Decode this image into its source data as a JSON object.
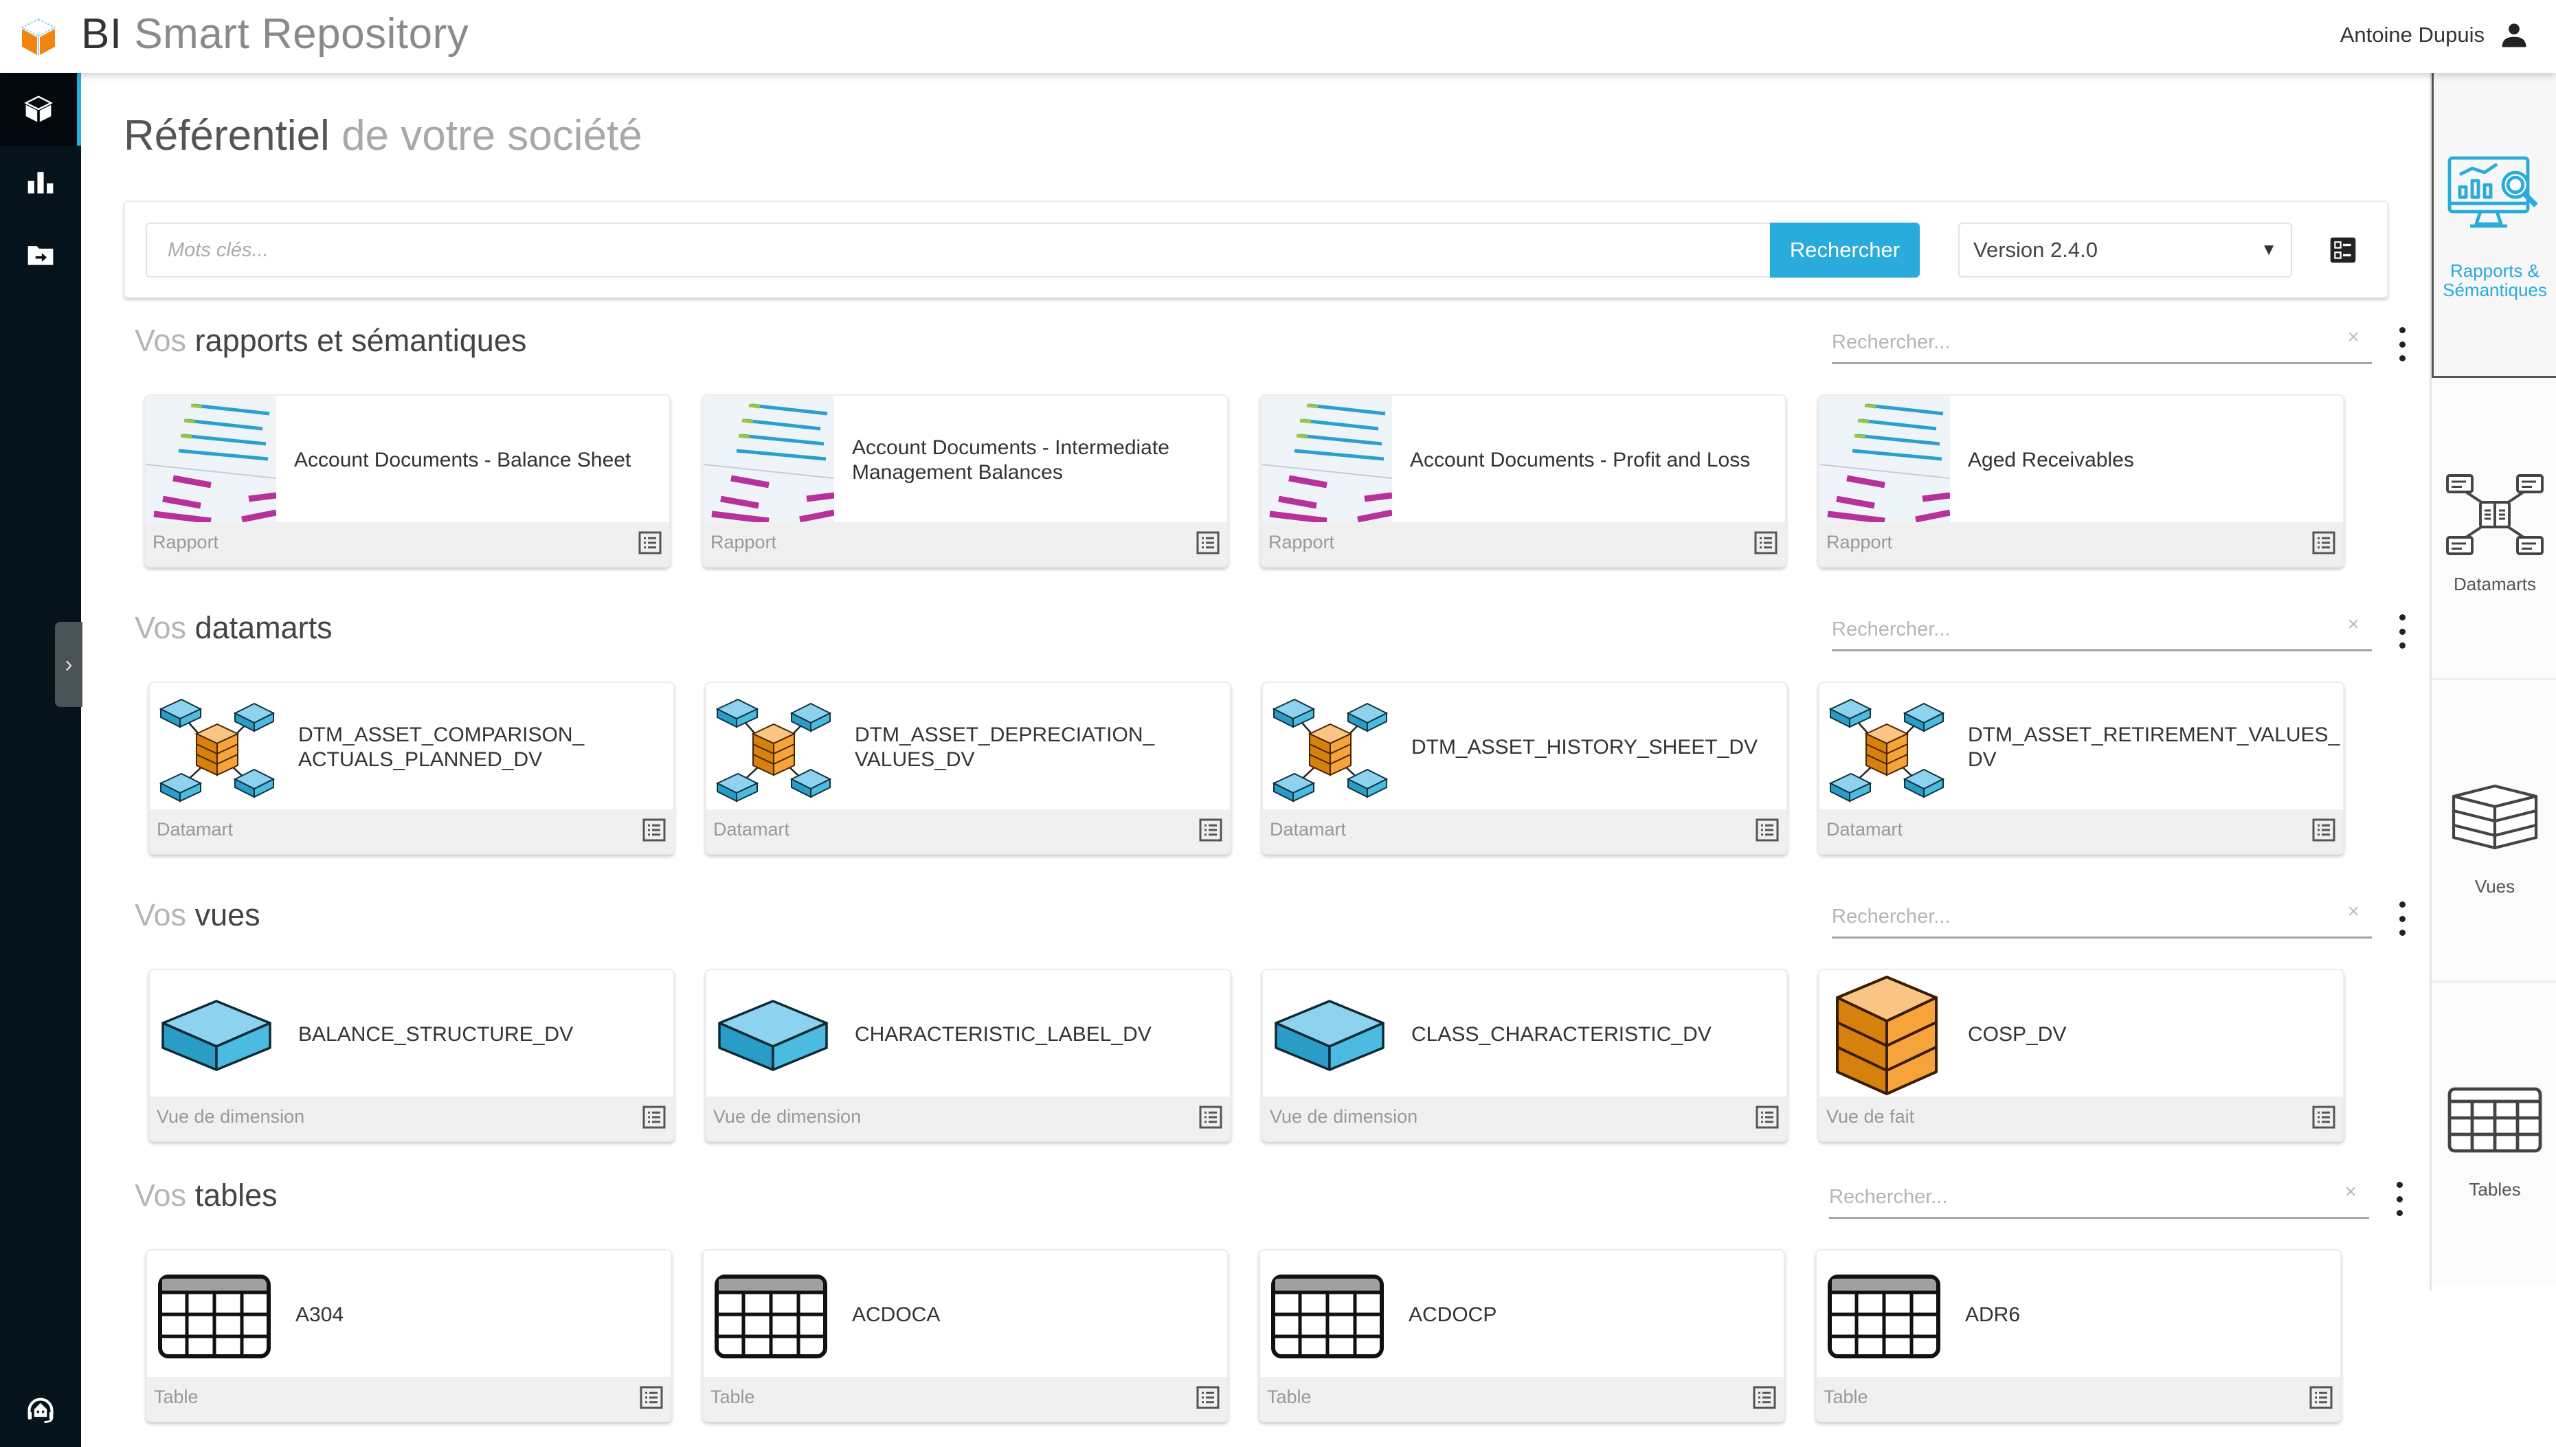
{
  "app": {
    "title_strong": "BI",
    "title_rest": "Smart Repository",
    "user_name": "Antoine Dupuis",
    "accent": "#29abdb"
  },
  "left_sidebar": {
    "items": [
      {
        "name": "repository",
        "icon": "cube-icon",
        "active": true
      },
      {
        "name": "statistics",
        "icon": "bar-chart-icon",
        "active": false
      },
      {
        "name": "import",
        "icon": "folder-arrow-icon",
        "active": false
      }
    ],
    "bottom_icon": "support-headset-icon",
    "collapse_label": "›"
  },
  "page": {
    "title_strong": "Référentiel",
    "title_light": "de votre société"
  },
  "search": {
    "placeholder": "Mots clés...",
    "value": "",
    "button_label": "Rechercher",
    "version": "Version 2.4.0"
  },
  "sections": [
    {
      "prefix": "Vos",
      "title": "rapports et sémantiques",
      "filter_placeholder": "Rechercher...",
      "clear_label": "×",
      "cards": [
        {
          "name": "Account Documents - Balance Sheet",
          "type": "Rapport"
        },
        {
          "name": "Account Documents - Intermediate Management Balances",
          "type": "Rapport"
        },
        {
          "name": "Account Documents - Profit and Loss",
          "type": "Rapport"
        },
        {
          "name": "Aged Receivables",
          "type": "Rapport"
        }
      ]
    },
    {
      "prefix": "Vos",
      "title": "datamarts",
      "filter_placeholder": "Rechercher...",
      "clear_label": "×",
      "cards": [
        {
          "name": "DTM_ASSET_COMPARISON_ ACTUALS_PLANNED_DV",
          "type": "Datamart"
        },
        {
          "name": "DTM_ASSET_DEPRECIATION_ VALUES_DV",
          "type": "Datamart"
        },
        {
          "name": "DTM_ASSET_HISTORY_SHEET_DV",
          "type": "Datamart"
        },
        {
          "name": "DTM_ASSET_RETIREMENT_VALUES_ DV",
          "type": "Datamart"
        }
      ]
    },
    {
      "prefix": "Vos",
      "title": "vues",
      "filter_placeholder": "Rechercher...",
      "clear_label": "×",
      "cards": [
        {
          "name": "BALANCE_STRUCTURE_DV",
          "type": "Vue de dimension"
        },
        {
          "name": "CHARACTERISTIC_LABEL_DV",
          "type": "Vue de dimension"
        },
        {
          "name": "CLASS_CHARACTERISTIC_DV",
          "type": "Vue de dimension"
        },
        {
          "name": "COSP_DV",
          "type": "Vue de fait"
        }
      ]
    },
    {
      "prefix": "Vos",
      "title": "tables",
      "filter_placeholder": "Rechercher...",
      "clear_label": "×",
      "cards": [
        {
          "name": "A304",
          "type": "Table"
        },
        {
          "name": "ACDOCA",
          "type": "Table"
        },
        {
          "name": "ACDOCP",
          "type": "Table"
        },
        {
          "name": "ADR6",
          "type": "Table"
        }
      ]
    }
  ],
  "right_panel": {
    "items": [
      {
        "label": "Rapports & Sémantiques",
        "icon": "report-monitor-icon",
        "active": true
      },
      {
        "label": "Datamarts",
        "icon": "datamart-icon",
        "active": false
      },
      {
        "label": "Vues",
        "icon": "view-cube-icon",
        "active": false
      },
      {
        "label": "Tables",
        "icon": "table-grid-icon",
        "active": false
      }
    ]
  }
}
